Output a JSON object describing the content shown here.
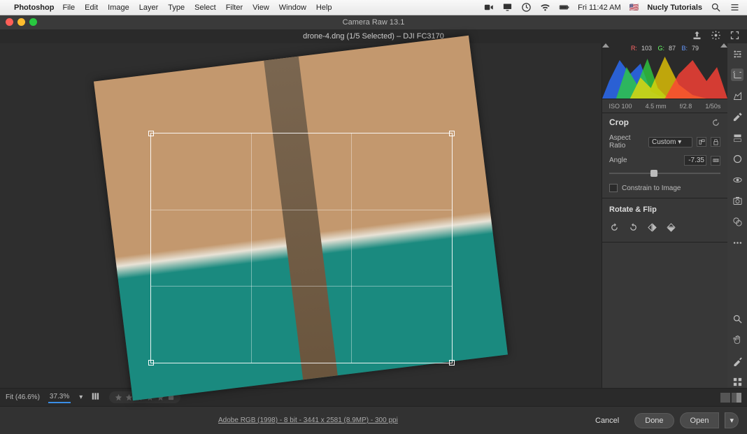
{
  "macbar": {
    "app": "Photoshop",
    "menus": [
      "File",
      "Edit",
      "Image",
      "Layer",
      "Type",
      "Select",
      "Filter",
      "View",
      "Window",
      "Help"
    ],
    "clock": "Fri 11:42 AM",
    "user": "Nucly Tutorials"
  },
  "title": "Camera Raw 13.1",
  "file_header": "drone-4.dng (1/5 Selected)  –  DJI FC3170",
  "readout": {
    "r_label": "R:",
    "r": "103",
    "g_label": "G:",
    "g": "87",
    "b_label": "B:",
    "b": "79"
  },
  "meta": {
    "iso": "ISO 100",
    "focal": "4.5 mm",
    "aperture": "f/2.8",
    "shutter": "1/50s"
  },
  "crop": {
    "title": "Crop",
    "aspect_label": "Aspect Ratio",
    "aspect_value": "Custom",
    "angle_label": "Angle",
    "angle_value": "-7.35",
    "constrain_label": "Constrain to Image",
    "rotate_flip_title": "Rotate & Flip"
  },
  "status": {
    "fit": "Fit (46.6%)",
    "zoom": "37.3%"
  },
  "bottom": {
    "meta": "Adobe RGB (1998) - 8 bit - 3441 x 2581 (8.9MP) - 300 ppi",
    "cancel": "Cancel",
    "done": "Done",
    "open": "Open"
  }
}
